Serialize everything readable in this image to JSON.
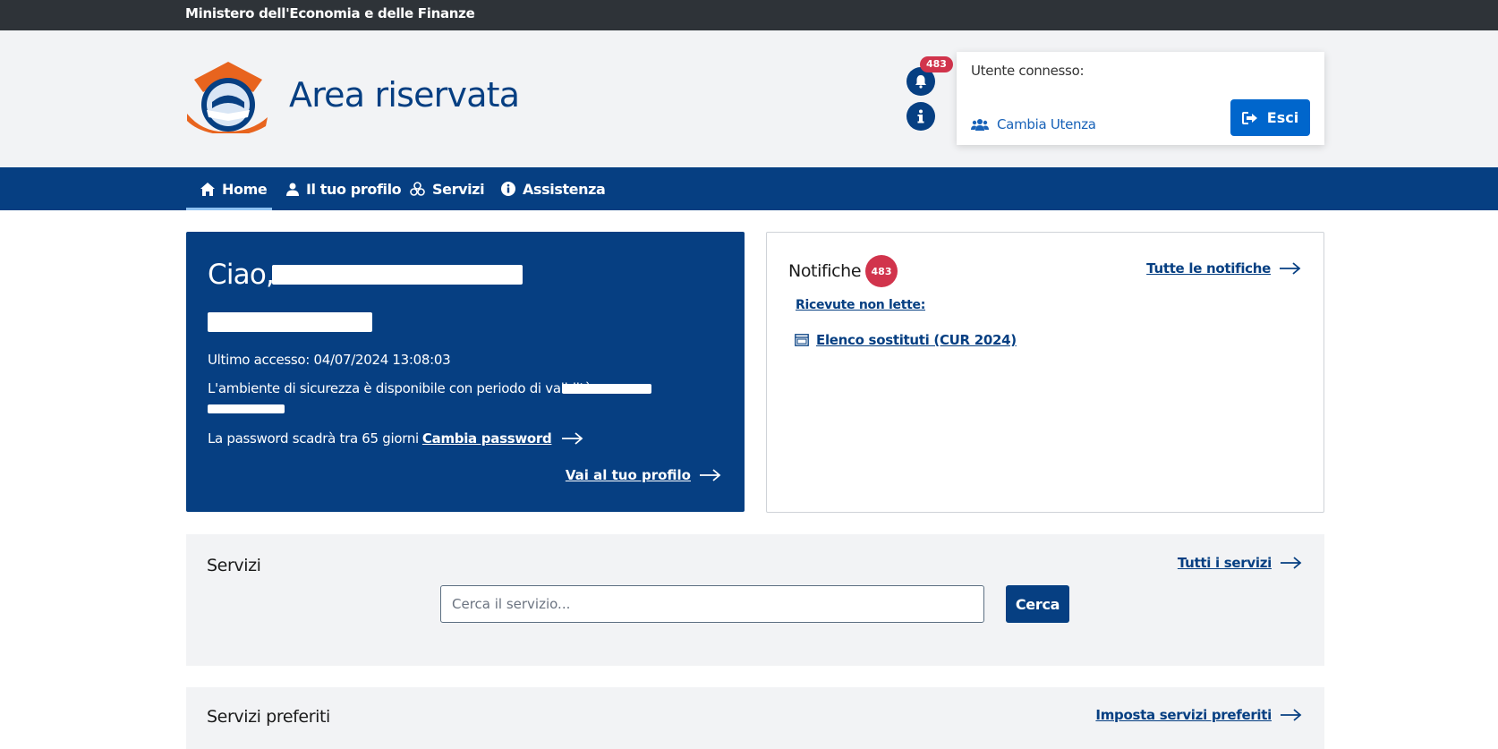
{
  "topbar": {
    "title": "Ministero dell'Economia e delle Finanze"
  },
  "header": {
    "site_title": "Area riservata",
    "notifications_count": "483",
    "user_label": "Utente connesso:",
    "switch_user": "Cambia Utenza",
    "logout": "Esci"
  },
  "nav": {
    "items": [
      {
        "label": "Home",
        "icon": "home-icon",
        "active": true
      },
      {
        "label": "Il tuo profilo",
        "icon": "user-icon",
        "active": false
      },
      {
        "label": "Servizi",
        "icon": "services-icon",
        "active": false
      },
      {
        "label": "Assistenza",
        "icon": "info-icon",
        "active": false
      }
    ]
  },
  "welcome": {
    "greeting": "Ciao,",
    "last_access": "Ultimo accesso: 04/07/2024 13:08:03",
    "security_env": "L'ambiente di sicurezza è disponibile con periodo di validità",
    "password_expiry": "La password scadrà tra 65 giorni",
    "change_password": "Cambia password",
    "profile_link": "Vai al tuo profilo"
  },
  "notifications": {
    "title": "Notifiche",
    "count": "483",
    "all_link": "Tutte le notifiche",
    "unread_label": "Ricevute non lette:",
    "items": [
      {
        "label": "Elenco sostituti (CUR 2024)"
      }
    ]
  },
  "services": {
    "title": "Servizi",
    "all_link": "Tutti i servizi",
    "search_placeholder": "Cerca il servizio...",
    "search_button": "Cerca"
  },
  "favorites": {
    "title": "Servizi preferiti",
    "set_link": "Imposta servizi preferiti"
  },
  "colors": {
    "primary": "#063f82",
    "accent_orange": "#e8641e",
    "badge_red": "#d1344c",
    "button_blue": "#0066cc",
    "topbar": "#2e3338",
    "header_bg": "#f2f3f5"
  }
}
